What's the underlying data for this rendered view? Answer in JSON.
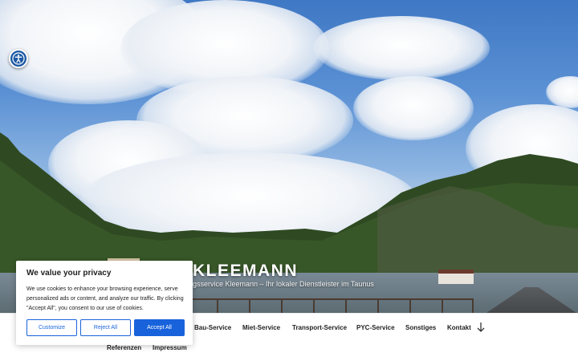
{
  "accessibility": {
    "icon": "accessibility-icon"
  },
  "site": {
    "title": "KLEEMANN",
    "tagline": "gsservice Kleemann – Ihr lokaler Dienstleister im Taunus"
  },
  "nav": {
    "items": [
      {
        "label": "Bau-Service"
      },
      {
        "label": "Miet-Service"
      },
      {
        "label": "Transport-Service"
      },
      {
        "label": "PYC-Service"
      },
      {
        "label": "Sonstiges"
      },
      {
        "label": "Kontakt"
      },
      {
        "label": "Referenzen"
      },
      {
        "label": "Impressum"
      }
    ],
    "scroll_icon": "arrow-down-icon"
  },
  "cookie": {
    "title": "We value your privacy",
    "text": "We use cookies to enhance your browsing experience, serve personalized ads or content, and analyze our traffic. By clicking \"Accept All\", you consent to our use of cookies.",
    "customize_label": "Customize",
    "reject_label": "Reject All",
    "accept_label": "Accept All",
    "accent_color": "#1863dc"
  }
}
